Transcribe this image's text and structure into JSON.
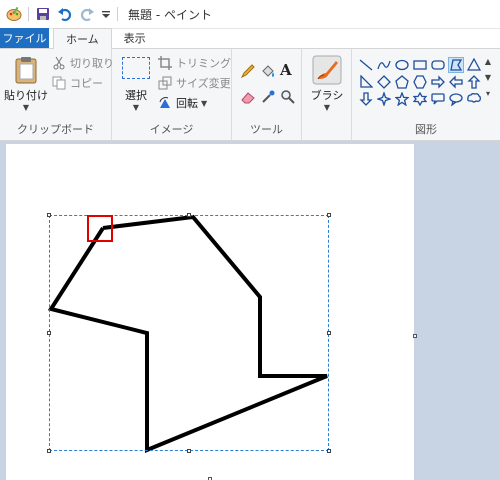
{
  "window": {
    "title": "無題 - ペイント"
  },
  "tabs": {
    "file": "ファイル",
    "home": "ホーム",
    "view": "表示"
  },
  "ribbon": {
    "clipboard": {
      "paste": "貼り付け",
      "cut": "切り取り",
      "copy": "コピー",
      "group": "クリップボード"
    },
    "image": {
      "select": "選択",
      "crop": "トリミング",
      "resize": "サイズ変更",
      "rotate": "回転",
      "group": "イメージ"
    },
    "tools": {
      "group": "ツール"
    },
    "brushes": {
      "label": "ブラシ"
    },
    "shapes": {
      "group": "図形"
    }
  },
  "colors": {
    "file_tab": "#1e6fc2",
    "canvas_bg": "#c8d3e3",
    "selection": "#2a7fd4",
    "highlight": "#e00000"
  },
  "icons": {
    "quick_access": [
      "paint-app-icon",
      "save-icon",
      "undo-icon",
      "redo-icon",
      "customize-qat-icon"
    ],
    "tools": [
      "pencil-icon",
      "fill-icon",
      "text-icon",
      "eraser-icon",
      "color-picker-icon",
      "magnifier-icon"
    ]
  }
}
